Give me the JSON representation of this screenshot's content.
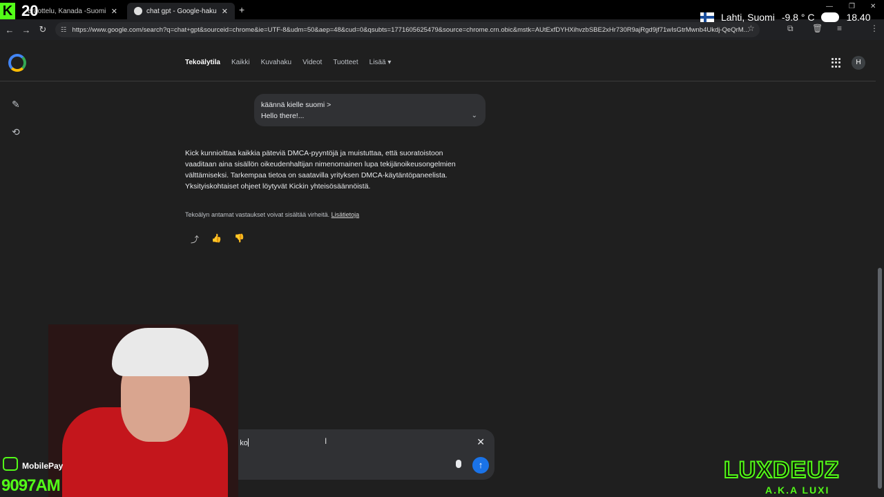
{
  "overlay": {
    "kick_letter": "K",
    "kick_count": "20",
    "location": "Lahti, Suomi",
    "temperature": "-9.8 ° C",
    "time": "18.40",
    "mobilepay_label": "MobilePay",
    "mobilepay_number": "9097AM",
    "brand_name": "LUXDEUZ",
    "brand_aka": "A.K.A LUXI"
  },
  "browser": {
    "tabs": [
      {
        "title": "eräottelu, Kanada -Suomi | ..."
      },
      {
        "title": "chat gpt - Google-haku"
      }
    ],
    "url": "https://www.google.com/search?q=chat+gpt&sourceid=chrome&ie=UTF-8&udm=50&aep=48&cud=0&qsubts=1771605625479&source=chrome.crn.obic&mstk=AUtExfDYHXihvzbSBE2xHr730R9ajRgd9jf71wIsGtrMwnb4Ukdj-QeQrM..."
  },
  "google": {
    "nav": [
      "Tekoälytila",
      "Kaikki",
      "Kuvahaku",
      "Videot",
      "Tuotteet",
      "Lisää"
    ],
    "avatar_letter": "H",
    "query_line1": "käännä kielle suomi >",
    "query_line2": "Hello there!...",
    "answer": "Kick kunnioittaa kaikkia päteviä DMCA-pyyntöjä ja muistuttaa, että suoratoistoon vaaditaan aina sisällön oikeudenhaltijan nimenomainen lupa tekijänoikeusongelmien välttämiseksi. Tarkempaa tietoa on saatavilla yrityksen DMCA-käytäntöpaneelista. Yksityiskohtaiset ohjeet löytyvät Kickin yhteisösäännöistä.",
    "disclaimer": "Tekoälyn antamat vastaukset voivat sisältää virheitä.",
    "disclaimer_link": "Lisätietoja",
    "composer_text": "uorana ko"
  }
}
